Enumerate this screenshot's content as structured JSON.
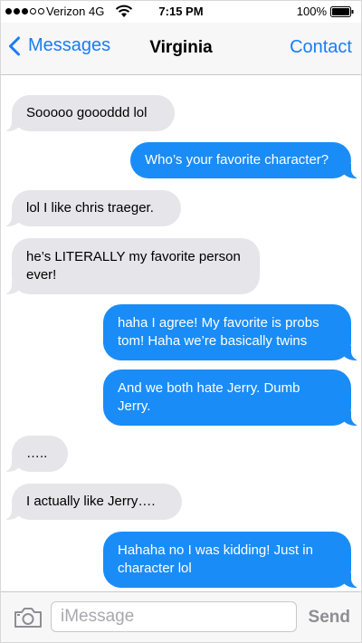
{
  "status_bar": {
    "carrier": "Verizon 4G",
    "signal_bars_filled": 3,
    "signal_bars_total": 5,
    "time": "7:15 PM",
    "battery": "100%",
    "icons": [
      "signal-dots-icon",
      "wifi-icon",
      "battery-icon"
    ]
  },
  "nav": {
    "back_label": "Messages",
    "title": "Virginia",
    "contact_label": "Contact",
    "back_icon": "chevron-left-icon"
  },
  "messages": [
    {
      "from": "incoming",
      "text": "Sooooo goooddd lol"
    },
    {
      "from": "outgoing",
      "text": "Who’s your favorite character?"
    },
    {
      "from": "incoming",
      "text": "lol I like chris traeger."
    },
    {
      "from": "incoming",
      "text": "he’s LITERALLY my favorite person ever!"
    },
    {
      "from": "outgoing",
      "text": "haha I agree! My favorite is probs tom! Haha we’re basically twins"
    },
    {
      "from": "outgoing",
      "text": "And we both hate Jerry. Dumb Jerry."
    },
    {
      "from": "incoming",
      "text": "….."
    },
    {
      "from": "incoming",
      "text": "I actually like Jerry…."
    },
    {
      "from": "outgoing",
      "text": "Hahaha no I was kidding! Just in character lol"
    }
  ],
  "input_bar": {
    "placeholder": "iMessage",
    "value": "",
    "send_label": "Send",
    "camera_icon": "camera-icon"
  },
  "colors": {
    "accent": "#1a7cf5",
    "outgoing_bubble": "#1a8cf7",
    "incoming_bubble": "#e5e5ea",
    "send_disabled": "#8e8e93"
  }
}
